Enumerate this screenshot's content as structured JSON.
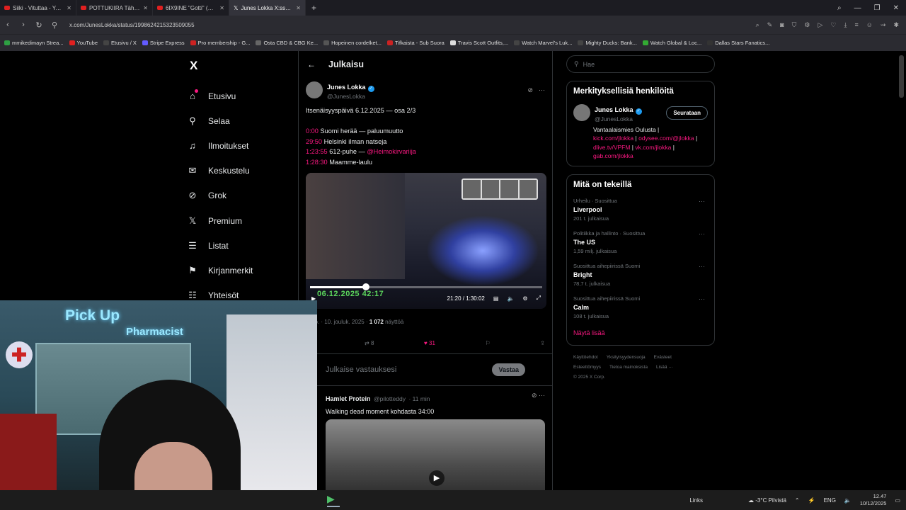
{
  "tabs": [
    {
      "title": "Siiki - Vituttaa - YouTube",
      "active": false
    },
    {
      "title": "POTTUKIIRA Tähtäimessä",
      "active": false
    },
    {
      "title": "6IX9INE \"Gotti\" (WSHH E",
      "active": false
    },
    {
      "title": "Junes Lokka X:ssä: \"Itsenäi",
      "active": true
    }
  ],
  "url": "x.com/JunesLokka/status/1998624215323509055",
  "bookmarks": [
    {
      "label": "mmikedimayn Strea...",
      "color": "#2ea043"
    },
    {
      "label": "YouTube",
      "color": "#e02020"
    },
    {
      "label": "Etusivu / X",
      "color": "#444"
    },
    {
      "label": "Stripe Express",
      "color": "#635bff"
    },
    {
      "label": "Pro membership - G...",
      "color": "#c22"
    },
    {
      "label": "Osta CBD & CBG Ke...",
      "color": "#666"
    },
    {
      "label": "Hopeinen cordelket...",
      "color": "#555"
    },
    {
      "label": "Tifkaista - Sub Suora",
      "color": "#c22"
    },
    {
      "label": "Travis Scott Outfits,...",
      "color": "#ddd"
    },
    {
      "label": "Watch Marvel's Luk...",
      "color": "#444"
    },
    {
      "label": "Mighty Ducks: Bank...",
      "color": "#444"
    },
    {
      "label": "Watch Global & Loc...",
      "color": "#3a3"
    },
    {
      "label": "Dallas Stars Fanatics...",
      "color": "#333"
    }
  ],
  "nav": {
    "logo": "X",
    "items": [
      "Etusivu",
      "Selaa",
      "Ilmoitukset",
      "Keskustelu",
      "Grok",
      "Premium",
      "Listat",
      "Kirjanmerkit",
      "Yhteisöt"
    ]
  },
  "post": {
    "header": "Julkaisu",
    "name": "Junes Lokka",
    "handle": "@JunesLokka",
    "title": "Itsenäisyyspäivä 6.12.2025 — osa 2/3",
    "chapters": [
      {
        "ts": "0:00",
        "text": "Suomi herää — paluumuutto"
      },
      {
        "ts": "29:50",
        "text": "Helsinki ilman natseja"
      },
      {
        "ts": "1:23:55",
        "text": "612-puhe — ",
        "mention": "@Heimokirvariija"
      },
      {
        "ts": "1:28:30",
        "text": "Maamme-laulu"
      }
    ],
    "video": {
      "overlay_date": "06.12.2025 ",
      "overlay_time": "42:17",
      "time": "21:20 / 1:30:02",
      "progress": 0.24
    },
    "meta_date": "ap. · 10. jouluk. 2025 · ",
    "views": "1 072",
    "views_label": "näyttöä",
    "replies": "2",
    "reposts": "8",
    "likes": "31",
    "reply_placeholder": "Julkaise vastauksesi",
    "reply_button": "Vastaa"
  },
  "reply_tweet": {
    "name": "Hamlet Protein",
    "handle": "@pilotteddy",
    "time": "· 11 min",
    "text": "Walking dead moment kohdasta 34:00"
  },
  "search_placeholder": "Hae",
  "people_card": {
    "title": "Merkityksellisiä henkilöitä",
    "name": "Junes Lokka",
    "handle": "@JunesLokka",
    "follow": "Seurataan",
    "bio": "Vantaalaismies Oulusta |",
    "links": [
      "kick.com/jlokka",
      "odysee.com/@jlokka",
      "dlive.tv/VPFM",
      "vk.com/jlokka",
      "gab.com/jlokka"
    ]
  },
  "trends_card": {
    "title": "Mitä on tekeillä",
    "items": [
      {
        "category": "Urheilu · Suosittua",
        "name": "Liverpool",
        "count": "201 t. julkaisua"
      },
      {
        "category": "Politiikka ja hallinto · Suosittua",
        "name": "The US",
        "count": "1,59 milj. julkaisua"
      },
      {
        "category": "Suosittua aihepiirissä Suomi",
        "name": "Bright",
        "count": "78,7 t. julkaisua"
      },
      {
        "category": "Suosittua aihepiirissä Suomi",
        "name": "Calm",
        "count": "108 t. julkaisua"
      }
    ],
    "show_more": "Näytä lisää"
  },
  "footer": {
    "line1": [
      "Käyttöehdot",
      "Yksityisyydensuoja",
      "Evästeet"
    ],
    "line2": [
      "Esteettömyys",
      "Tietoa mainoksista",
      "Lisää ···"
    ],
    "copyright": "© 2025 X Corp."
  },
  "webcam": {
    "sign1": "Pick Up",
    "sign2": "Pharmacist"
  },
  "taskbar": {
    "links": "Links",
    "weather": "-3°C  Pilvistä",
    "lang": "ENG",
    "time": "12.47",
    "date": "10/12/2025"
  },
  "colors": {
    "accent": "#f91880",
    "verified": "#1d9bf0",
    "background": "#000000"
  }
}
